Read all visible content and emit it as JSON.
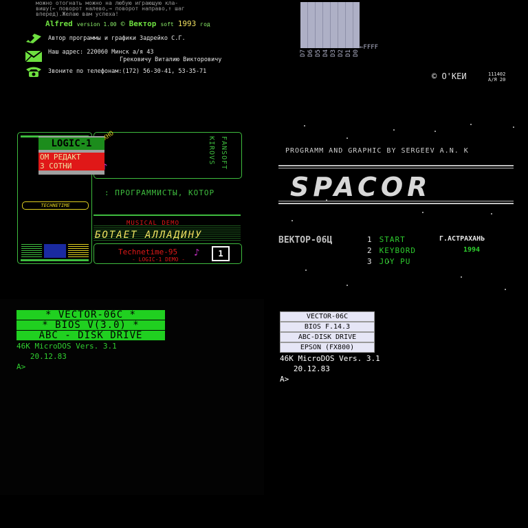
{
  "q1": {
    "top_lines": [
      "можно отогнать можно на любую играющую кла-",
      "вишу(← поворот налево,→ поворот направо,↑ шаг",
      "вперед).Желаю  вам  успеха!"
    ],
    "alfred": "Alfred",
    "version": "version 1.00",
    "copyright": "©",
    "vektor_soft": "Вектор",
    "soft": "soft",
    "year": "1993",
    "year_suffix": "год",
    "author": "Автор программы  и графики  Задрейко С.Г.",
    "address_l1": "Наш адрес: 220060   Минск  а/я  43",
    "address_l2": "Грековичу  Виталию Викторовичу",
    "phone": "Звоните  по  телефонам:(172)  56-30-41, 53-35-71",
    "colors": {
      "green": "#6ee040",
      "yellow": "#f0e060"
    }
  },
  "q2": {
    "bus_labels": [
      "D7",
      "D6",
      "D5",
      "D4",
      "D3",
      "D2",
      "D1",
      "D0"
    ],
    "ffff": "←FFFF",
    "okei": "© О'КЕИ",
    "code_l1": "111402",
    "code_l2": "А/Я 20"
  },
  "q3": {
    "techno": "TEXHO",
    "logic_title": "LOGIC-1",
    "red_l1": "ОМ РЕДАКТ",
    "red_l2": "З СОТНИ",
    "kirov": "KIROVS",
    "fansoft": "FANSOFT",
    "technetime_small": "TECHNETIME",
    "scroll": ": ПРОГРАММИСТЫ,  КОТОР",
    "musical": "MUSICAL  DEMO",
    "zabot": "БОТАЕТ   АЛЛАДИНУ",
    "technetime": "Technetime-95",
    "demo": "- LOGIC-1 DEMO -",
    "badge": "1"
  },
  "q4": {
    "prog": "PROGRAMM AND GRAPHIC BY SERGEEV A.N.   K",
    "title": "SPACOR",
    "vektor": "ВЕКТОР-06Ц",
    "city": "Г.АСТРАХАНЬ",
    "year": "1994",
    "menu": [
      {
        "num": "1",
        "label": "START"
      },
      {
        "num": "2",
        "label": "KEYBORD"
      },
      {
        "num": "3",
        "label": "JOY PU"
      }
    ]
  },
  "q5": {
    "bar1": "* VECTOR-06C *",
    "bar2": "* BIOS  V(3.0) *",
    "bar3": "ABC - DISK DRIVE",
    "l1": "46K MicroDOS  Vers. 3.1",
    "l2": "   20.12.83",
    "prompt": "A>"
  },
  "q6": {
    "bar1": "VECTOR-06C",
    "bar2": "BIOS  F.14.3",
    "bar3": "ABC-DISK DRIVE",
    "bar4": "EPSON (FX800)",
    "l1": "46K MicroDOS  Vers. 3.1",
    "l2": "   20.12.83",
    "prompt": "A>"
  }
}
